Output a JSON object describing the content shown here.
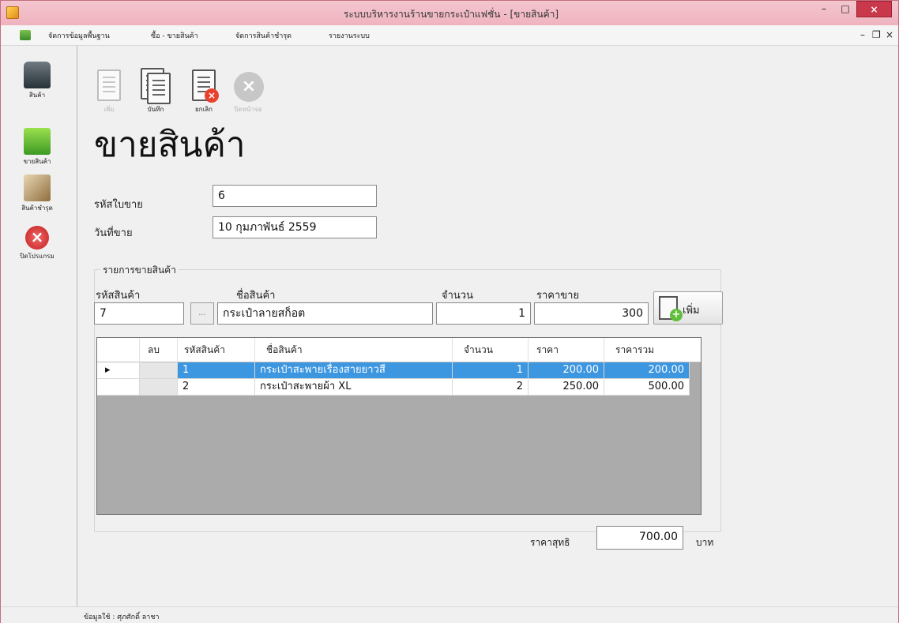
{
  "window": {
    "title": "ระบบบริหารงานร้านขายกระเป๋าแฟชั่น - [ขายสินค้า]",
    "minimize": "–",
    "maximize": "□",
    "close": "×"
  },
  "menu": {
    "items": [
      "จัดการข้อมูลพื้นฐาน",
      "ซื้อ - ขายสินค้า",
      "จัดการสินค้าชำรุด",
      "รายงานระบบ"
    ],
    "mdi_minimize": "–",
    "mdi_restore": "ð",
    "mdi_close": "×"
  },
  "sidebar": {
    "items": [
      {
        "label": "สินค้า",
        "icon": "bag-icon"
      },
      {
        "label": "ขายสินค้า",
        "icon": "shopping-bag-icon"
      },
      {
        "label": "สินค้าชำรุด",
        "icon": "damaged-box-icon"
      },
      {
        "label": "ปิดโปรแกรม",
        "icon": "exit-icon"
      }
    ]
  },
  "toolbar": {
    "add_label": "เพิ่ม",
    "save_label": "บันทึก",
    "cancel_label": "ยกเลิก",
    "close_label": "ปิดหน้าจอ"
  },
  "form": {
    "title": "ขายสินค้า",
    "invoice_label": "รหัสใบขาย",
    "invoice_value": "6",
    "date_label": "วันที่ขาย",
    "date_value": "10 กุมภาพันธ์ 2559"
  },
  "item_entry": {
    "group_title": "รายการขายสินค้า",
    "code_label": "รหัสสินค้า",
    "code_value": "7",
    "browse_label": "...",
    "name_label": "ชื่อสินค้า",
    "name_value": "กระเป๋าลายสก็อต",
    "qty_label": "จำนวน",
    "qty_value": "1",
    "price_label": "ราคาขาย",
    "price_value": "300",
    "add_button_label": "เพิ่ม"
  },
  "grid": {
    "columns": [
      "ลบ",
      "รหัสสินค้า",
      "ชื่อสินค้า",
      "จำนวน",
      "ราคา",
      "ราคารวม"
    ],
    "rows": [
      {
        "code": "1",
        "name": "กระเป๋าสะพายเรื่องสายยาวสี",
        "qty": "1",
        "price": "200.00",
        "total": "200.00",
        "selected": true
      },
      {
        "code": "2",
        "name": "กระเป๋าสะพายผ้า XL",
        "qty": "2",
        "price": "250.00",
        "total": "500.00",
        "selected": false
      }
    ],
    "row_indicator": "▸"
  },
  "totals": {
    "label": "ราคาสุทธิ",
    "value": "700.00",
    "unit": "บาท"
  },
  "status": {
    "text": "ข้อมูลใช้ : ศุภศักดิ์ ลาชา"
  }
}
